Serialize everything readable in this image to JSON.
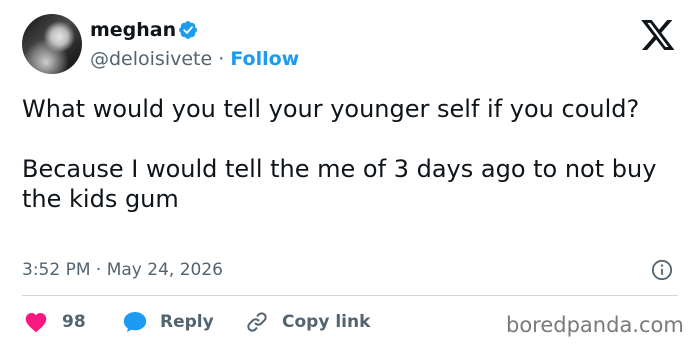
{
  "author": {
    "name": "meghan",
    "handle": "@deloisivete",
    "separator": "·",
    "follow_label": "Follow"
  },
  "tweet": {
    "paragraphs": [
      "What would you tell your younger self if you could?",
      "Because I would tell the me of 3 days ago to not buy the kids gum"
    ],
    "timestamp": "3:52 PM · May 24, 2026"
  },
  "actions": {
    "like_count": "98",
    "reply_label": "Reply",
    "copy_link_label": "Copy link"
  },
  "watermark": "boredpanda.com",
  "colors": {
    "accent": "#1d9bf0",
    "like": "#f91880",
    "text": "#0f1419",
    "muted": "#536471"
  },
  "icons": {
    "verified": "verified-badge-icon",
    "logo": "x-logo-icon",
    "info": "info-icon",
    "like": "heart-icon",
    "reply": "speech-bubble-icon",
    "copy": "link-icon"
  }
}
